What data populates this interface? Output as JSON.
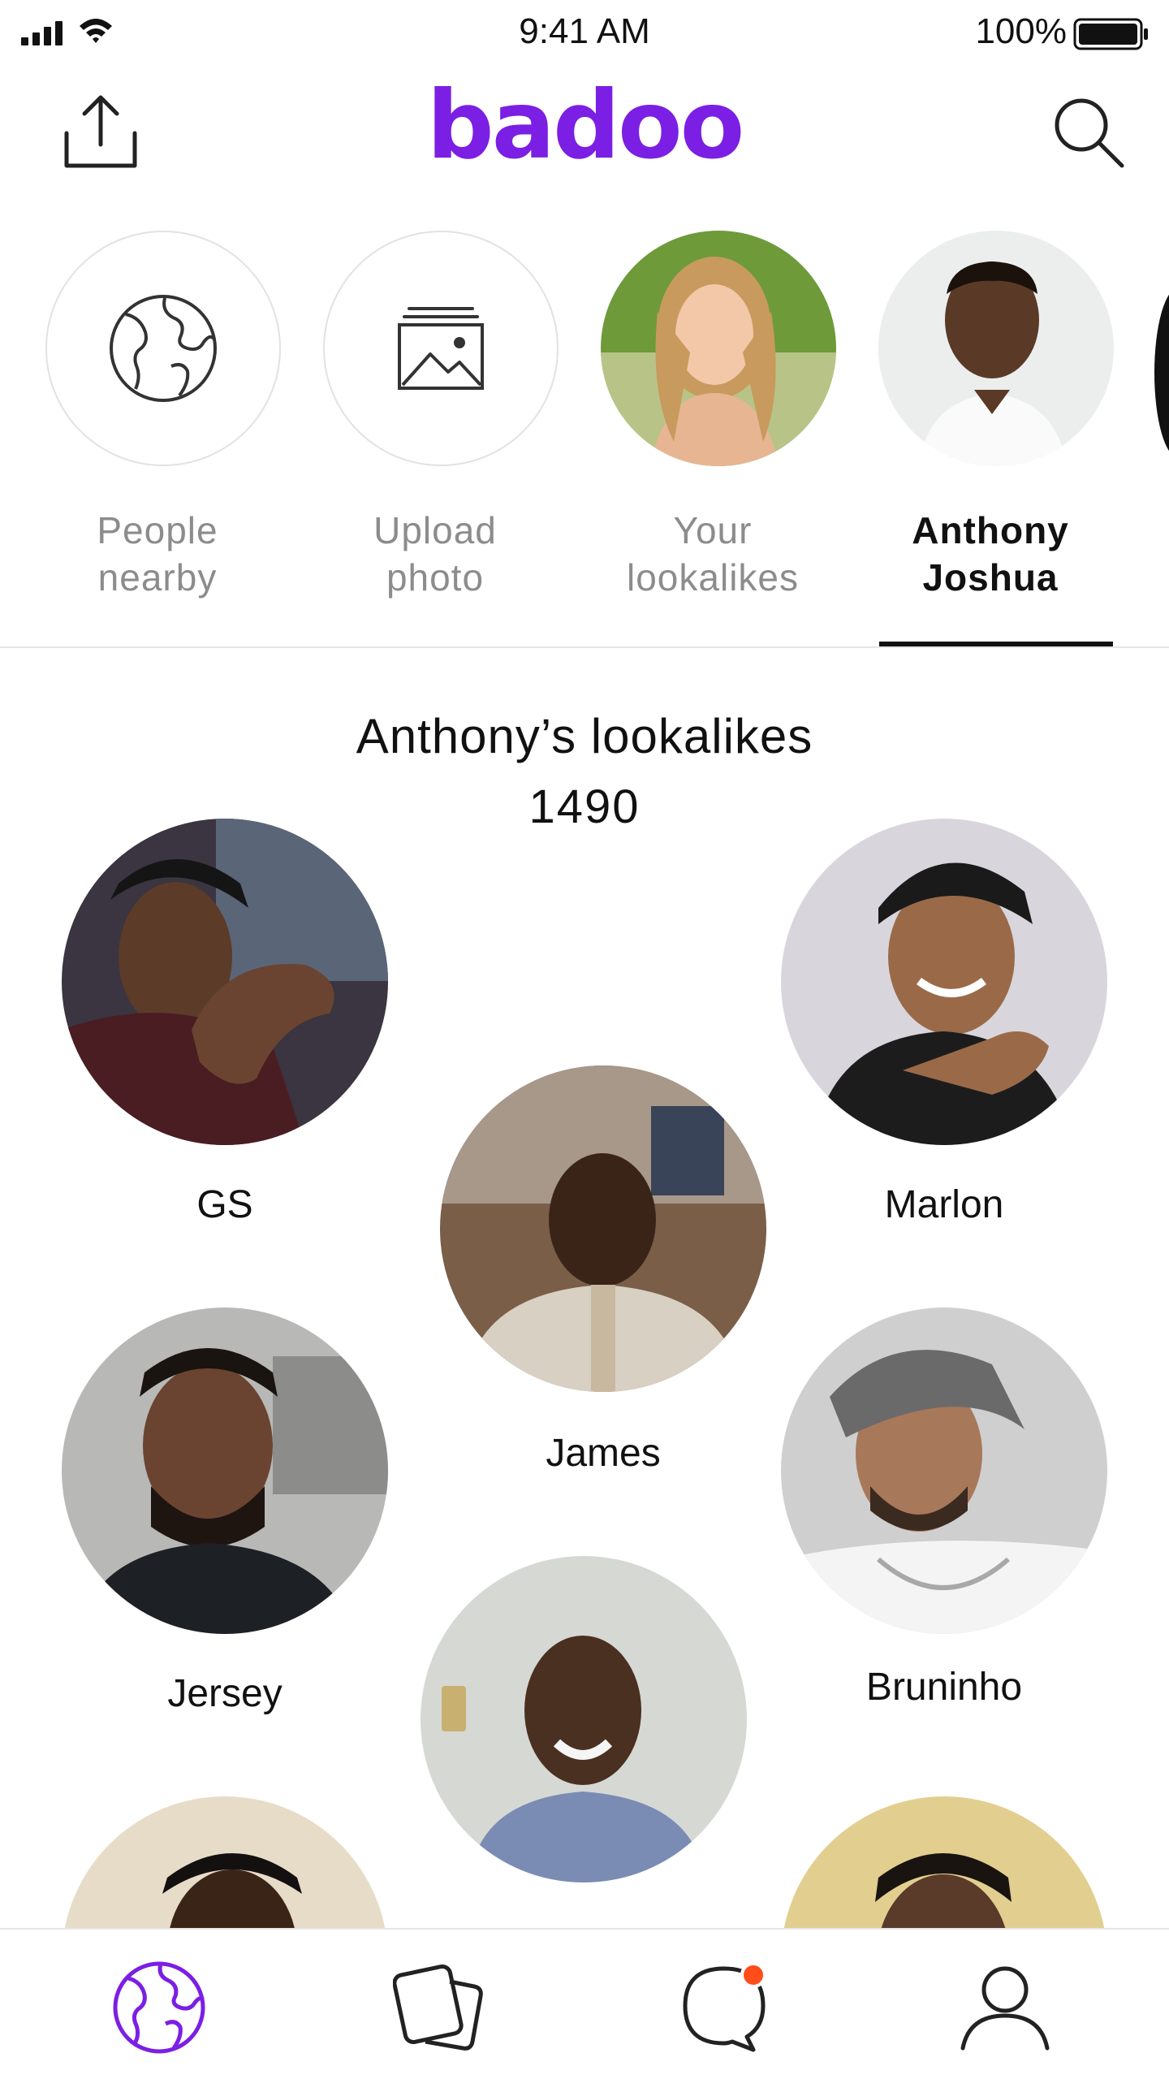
{
  "status_bar": {
    "time": "9:41 AM",
    "battery": "100%"
  },
  "header": {
    "logo": "badoo",
    "share_icon": "share-icon",
    "search_icon": "search-icon"
  },
  "colors": {
    "brand": "#7b1fe4",
    "notification": "#ff4d1a",
    "inactive_text": "#8c8c8c"
  },
  "selector": {
    "items": [
      {
        "line1": "People",
        "line2": "nearby",
        "icon": "globe-icon"
      },
      {
        "line1": "Upload",
        "line2": "photo",
        "icon": "image-upload-icon"
      },
      {
        "line1": "Your",
        "line2": "lookalikes",
        "icon": "profile-photo"
      },
      {
        "line1": "Anthony",
        "line2": "Joshua",
        "icon": "celebrity-photo",
        "selected": true
      }
    ]
  },
  "lookalikes": {
    "title": "Anthony’s lookalikes",
    "count": "1490",
    "people": [
      {
        "name": "GS"
      },
      {
        "name": "Marlon"
      },
      {
        "name": "James"
      },
      {
        "name": "Jersey"
      },
      {
        "name": "Bruninho"
      },
      {
        "name": ""
      },
      {
        "name": ""
      },
      {
        "name": ""
      }
    ]
  },
  "tab_bar": {
    "tabs": [
      {
        "icon": "globe-icon",
        "active": true
      },
      {
        "icon": "cards-icon",
        "active": false
      },
      {
        "icon": "chat-icon",
        "active": false,
        "badge": true
      },
      {
        "icon": "profile-icon",
        "active": false
      }
    ]
  }
}
